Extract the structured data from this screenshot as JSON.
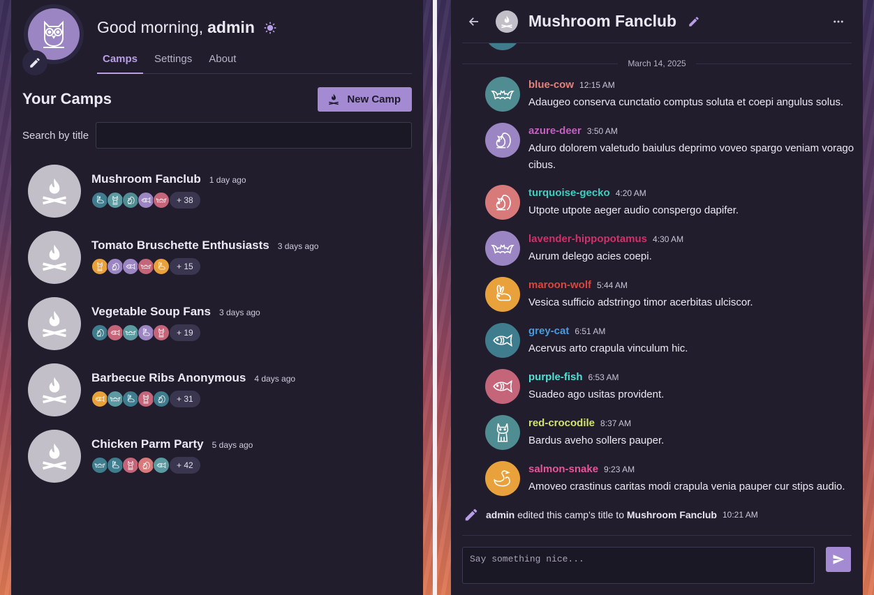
{
  "header": {
    "greeting_prefix": "Good morning,",
    "username": "admin",
    "tabs": [
      {
        "label": "Camps",
        "active": true
      },
      {
        "label": "Settings",
        "active": false
      },
      {
        "label": "About",
        "active": false
      }
    ]
  },
  "camps": {
    "title": "Your Camps",
    "new_button": "New Camp",
    "search_label": "Search by title",
    "search_value": "",
    "list": [
      {
        "name": "Mushroom Fanclub",
        "time": "1 day ago",
        "more": "+ 38",
        "members": [
          "#3f7d8e",
          "#5a9aa0",
          "#4f8d93",
          "#9b86c3",
          "#c4657a"
        ]
      },
      {
        "name": "Tomato Bruschette Enthusiasts",
        "time": "3 days ago",
        "more": "+ 15",
        "members": [
          "#e9a23b",
          "#9b86c3",
          "#9b86c3",
          "#c4657a",
          "#e9a23b"
        ]
      },
      {
        "name": "Vegetable Soup Fans",
        "time": "3 days ago",
        "more": "+ 19",
        "members": [
          "#3f7d8e",
          "#c4657a",
          "#5a9aa0",
          "#9b86c3",
          "#c4657a"
        ]
      },
      {
        "name": "Barbecue Ribs Anonymous",
        "time": "4 days ago",
        "more": "+ 31",
        "members": [
          "#e9a23b",
          "#5a9aa0",
          "#3f7d8e",
          "#c4657a",
          "#3f7d8e"
        ]
      },
      {
        "name": "Chicken Parm Party",
        "time": "5 days ago",
        "more": "+ 42",
        "members": [
          "#3f7d8e",
          "#3f7d8e",
          "#c4657a",
          "#d97a7a",
          "#5a9aa0"
        ]
      }
    ]
  },
  "chat": {
    "title": "Mushroom Fanclub",
    "date_divider": "March 14, 2025",
    "messages": [
      {
        "user": "blue-cow",
        "time": "12:15 AM",
        "text": "Adaugeo conserva cunctatio comptus soluta et coepi angulus solus.",
        "color": "#e8807a",
        "avatar": "#4f8d93",
        "icon": "bat"
      },
      {
        "user": "azure-deer",
        "time": "3:50 AM",
        "text": "Aduro dolorem valetudo baiulus deprimo voveo spargo veniam vorago cibus.",
        "color": "#c75fc0",
        "avatar": "#9b86c3",
        "icon": "squirrel"
      },
      {
        "user": "turquoise-gecko",
        "time": "4:20 AM",
        "text": "Utpote utpote aeger audio conspergo dapifer.",
        "color": "#3fcfc0",
        "avatar": "#d97a7a",
        "icon": "squirrel"
      },
      {
        "user": "lavender-hippopotamus",
        "time": "4:30 AM",
        "text": "Aurum delego acies coepi.",
        "color": "#d1316b",
        "avatar": "#9b86c3",
        "icon": "bat"
      },
      {
        "user": "maroon-wolf",
        "time": "5:44 AM",
        "text": "Vesica sufficio adstringo timor acerbitas ulciscor.",
        "color": "#d9473f",
        "avatar": "#e9a23b",
        "icon": "rabbit"
      },
      {
        "user": "grey-cat",
        "time": "6:51 AM",
        "text": "Acervus arto crapula vinculum hic.",
        "color": "#4a9be0",
        "avatar": "#3f7d8e",
        "icon": "fish"
      },
      {
        "user": "purple-fish",
        "time": "6:53 AM",
        "text": "Suadeo ago usitas provident.",
        "color": "#4fe3d6",
        "avatar": "#c4657a",
        "icon": "fish"
      },
      {
        "user": "red-crocodile",
        "time": "8:37 AM",
        "text": "Bardus aveho sollers pauper.",
        "color": "#d3e36f",
        "avatar": "#4f8d93",
        "icon": "cat"
      },
      {
        "user": "salmon-snake",
        "time": "9:23 AM",
        "text": "Amoveo crastinus caritas modi crapula venia pauper cur stips audio.",
        "color": "#e6569a",
        "avatar": "#e9a23b",
        "icon": "swan"
      }
    ],
    "system": {
      "user": "admin",
      "action": " edited this camp's title to ",
      "target": "Mushroom Fanclub",
      "time": "10:21 AM"
    },
    "composer_placeholder": "Say something nice..."
  }
}
